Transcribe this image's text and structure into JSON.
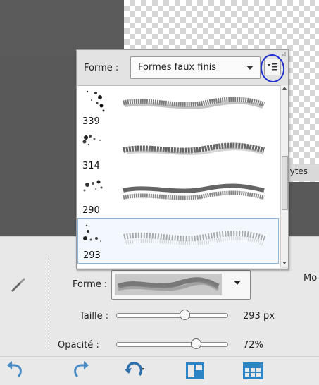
{
  "status": {
    "bytes_label": "bytes"
  },
  "brush_picker": {
    "forme_label": "Forme :",
    "library": "Formes faux finis",
    "brushes": [
      {
        "size": "339"
      },
      {
        "size": "314"
      },
      {
        "size": "290"
      },
      {
        "size": "293"
      }
    ],
    "selected_index": 3
  },
  "tool_options": {
    "forme_label": "Forme :",
    "mode_label_partial": "Mo",
    "taille_label": "Taille :",
    "taille_value": "293 px",
    "taille_fraction": 0.62,
    "opacite_label": "Opacité :",
    "opacite_value": "72%",
    "opacite_fraction": 0.72
  },
  "taskbar": {
    "icons": [
      "undo-icon",
      "redo-icon",
      "rotate-icon",
      "layout-icon",
      "organizer-icon"
    ]
  },
  "colors": {
    "annotation": "#1f2fd0",
    "selection_border": "#8fb6d6",
    "taskbar_icon": "#2d84c4"
  }
}
